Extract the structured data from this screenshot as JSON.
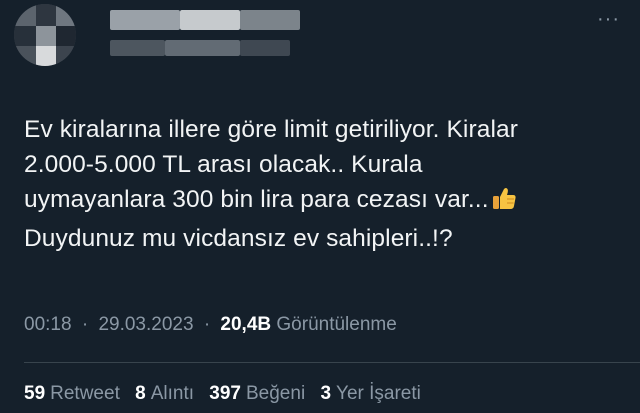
{
  "tweet": {
    "text_lines": [
      "Ev kiralarına illere göre limit getiriliyor. Kiralar",
      "2.000-5.000 TL arası olacak.. Kurala",
      "uymayanlara 300 bin lira para cezası var...",
      "Duydunuz mu vicdansız ev sahipleri..!?"
    ],
    "emoji": "thumbs-up-icon",
    "time": "00:18",
    "dot": "·",
    "date": "29.03.2023",
    "views_count": "20,4B",
    "views_label": "Görüntülenme"
  },
  "stats": {
    "retweets_count": "59",
    "retweets_label": "Retweet",
    "quotes_count": "8",
    "quotes_label": "Alıntı",
    "likes_count": "397",
    "likes_label": "Beğeni",
    "bookmarks_count": "3",
    "bookmarks_label": "Yer İşareti"
  },
  "more_icon": "···",
  "colors": {
    "background": "#15202b",
    "text": "#f2f4f5",
    "secondary": "#8b98a5",
    "divider": "#38444d"
  }
}
